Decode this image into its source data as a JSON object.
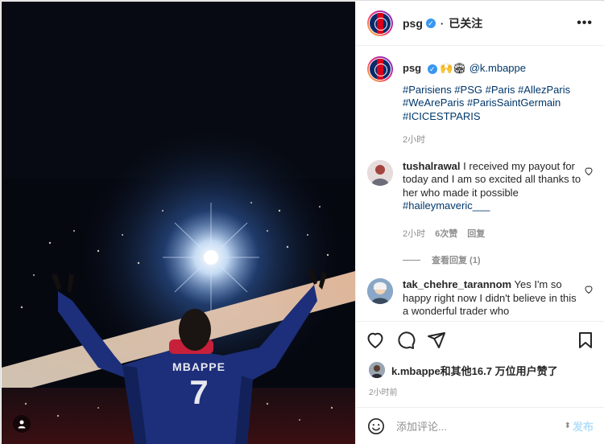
{
  "post": {
    "account": "psg",
    "follow_status": "已关注",
    "more_label": "•••"
  },
  "caption": {
    "username": "psg",
    "emojis": "🙌🏟",
    "mention": "@k.mbappe",
    "hashtags": "#Parisiens #PSG #Paris #AllezParis #WeAreParis #ParisSaintGermain #ICICESTPARIS",
    "time": "2小时"
  },
  "comments": [
    {
      "username": "tushalrawal",
      "text": "I received my payout for today and I am so excited all thanks to her who made it possible ",
      "tag": "#haileymaveric___",
      "time": "2小时",
      "likes": "6次赞",
      "reply": "回复",
      "view_replies": "查看回复 (1)"
    },
    {
      "username": "tak_chehre_tarannom",
      "text": "Yes I'm so happy right now I didn't believe in this a wonderful trader who"
    }
  ],
  "photo": {
    "jersey_name": "MBAPPE",
    "jersey_number": "7"
  },
  "liked_by": {
    "text": "k.mbappe和其他16.7 万位用户赞了"
  },
  "post_time": "2小时前",
  "add_comment": {
    "placeholder": "添加评论...",
    "post_label": "发布"
  },
  "colors": {
    "link": "#00376b",
    "verified": "#3897f0",
    "muted": "#8e8e8e",
    "post_disabled": "#b2dffc"
  }
}
